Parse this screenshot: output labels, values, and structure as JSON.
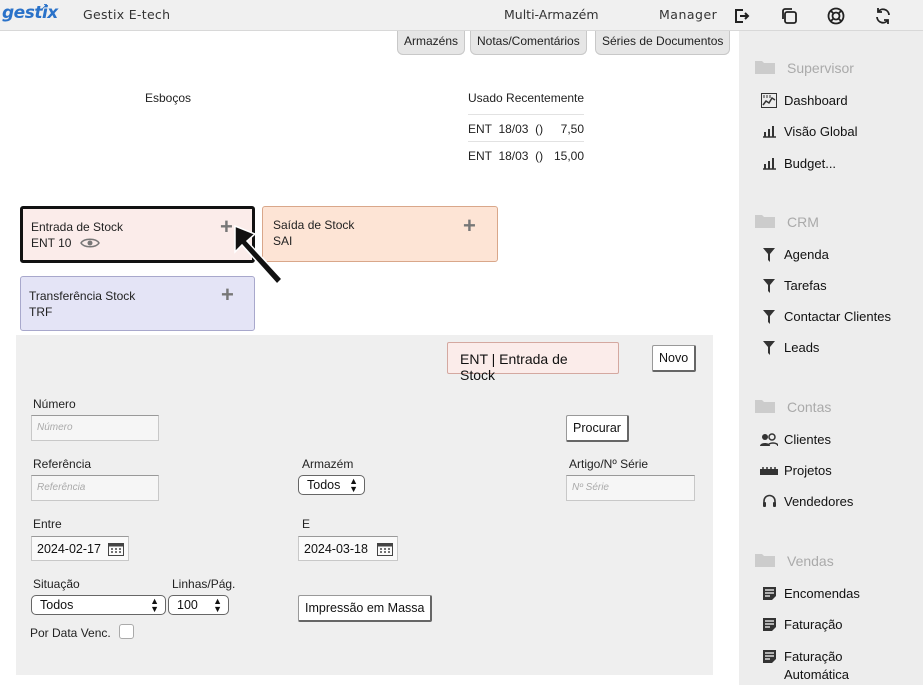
{
  "topbar": {
    "logo": "gestix",
    "company": "Gestix E-tech",
    "mode": "Multi-Armazém",
    "user": "Manager",
    "icons": [
      "logout-icon",
      "copy-icon",
      "help-lifebuoy-icon",
      "refresh-icon"
    ]
  },
  "tabs": [
    "Armazéns",
    "Notas/Comentários",
    "Séries de Documentos"
  ],
  "drafts": {
    "title": "Esboços"
  },
  "recent": {
    "title": "Usado Recentemente",
    "rows": [
      {
        "text": "ENT  18/03  ()",
        "value": "7,50"
      },
      {
        "text": "ENT  18/03  ()",
        "value": "15,00"
      }
    ]
  },
  "cards": [
    {
      "title": "Entrada de Stock",
      "code": "ENT 10",
      "color": "#fbecea"
    },
    {
      "title": "Saída de Stock",
      "code": "SAI",
      "color": "#fde4d5"
    },
    {
      "title": "Transferência Stock",
      "code": "TRF",
      "color": "#e4e4f6"
    }
  ],
  "search": {
    "doc_title": "ENT | Entrada de Stock",
    "new_label": "Novo",
    "number_label": "Número",
    "number_placeholder": "Número",
    "search_label": "Procurar",
    "reference_label": "Referência",
    "reference_placeholder": "Referência",
    "warehouse_label": "Armazém",
    "warehouse_value": "Todos",
    "article_label": "Artigo/Nº Série",
    "article_placeholder": "Nº Série",
    "from_label": "Entre",
    "from_value": "2024-02-17",
    "to_label": "E",
    "to_value": "2024-03-18",
    "status_label": "Situação",
    "status_value": "Todos",
    "lines_label": "Linhas/Pág.",
    "lines_value": "100",
    "bulk_print_label": "Impressão em Massa",
    "due_date_label": "Por Data Venc."
  },
  "sidebar": {
    "sections": [
      {
        "title": "Supervisor",
        "items": [
          "Dashboard",
          "Visão Global",
          "Budget..."
        ]
      },
      {
        "title": "CRM",
        "items": [
          "Agenda",
          "Tarefas",
          "Contactar Clientes",
          "Leads"
        ]
      },
      {
        "title": "Contas",
        "items": [
          "Clientes",
          "Projetos",
          "Vendedores"
        ]
      },
      {
        "title": "Vendas",
        "items": [
          "Encomendas",
          "Faturação",
          "Faturação Automática"
        ]
      }
    ]
  }
}
